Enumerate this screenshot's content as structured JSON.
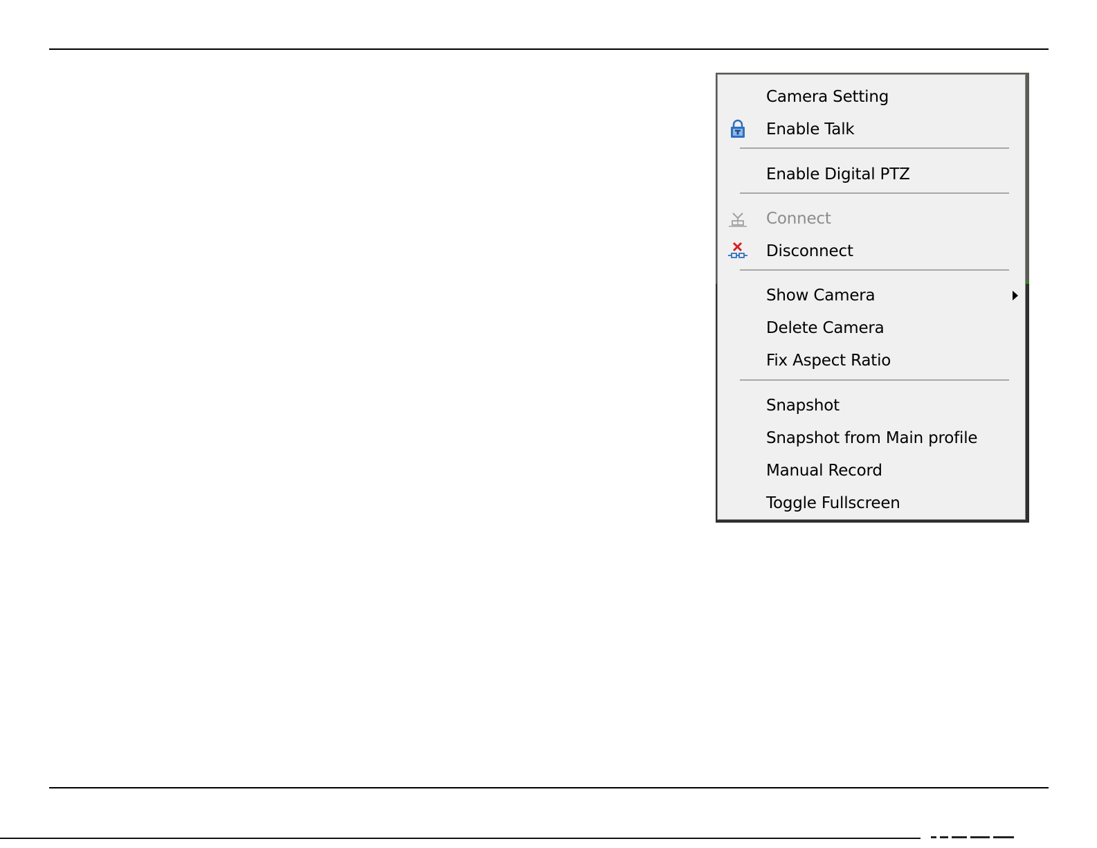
{
  "page": {
    "background": "#ffffff"
  },
  "context_menu": {
    "items": [
      {
        "label": "Camera Setting",
        "icon": "",
        "disabled": false,
        "submenu": false
      },
      {
        "label": "Enable Talk",
        "icon": "lock-talk-icon",
        "disabled": false,
        "submenu": false
      },
      {
        "label": "Enable Digital PTZ",
        "icon": "",
        "disabled": false,
        "submenu": false
      },
      {
        "label": "Connect",
        "icon": "connect-icon",
        "disabled": true,
        "submenu": false
      },
      {
        "label": "Disconnect",
        "icon": "disconnect-icon",
        "disabled": false,
        "submenu": false
      },
      {
        "label": "Show Camera",
        "icon": "",
        "disabled": false,
        "submenu": true
      },
      {
        "label": "Delete Camera",
        "icon": "",
        "disabled": false,
        "submenu": false
      },
      {
        "label": "Fix Aspect Ratio",
        "icon": "",
        "disabled": false,
        "submenu": false
      },
      {
        "label": "Snapshot",
        "icon": "",
        "disabled": false,
        "submenu": false
      },
      {
        "label": "Snapshot from Main profile",
        "icon": "",
        "disabled": false,
        "submenu": false
      },
      {
        "label": "Manual Record",
        "icon": "",
        "disabled": false,
        "submenu": false
      },
      {
        "label": "Toggle Fullscreen",
        "icon": "",
        "disabled": false,
        "submenu": false
      }
    ],
    "colors": {
      "menu_bg": "#f0f0f0",
      "text": "#000000",
      "disabled_text": "#8c8c8c",
      "separator": "#a8a8a8",
      "icon_blue": "#2f6fbf",
      "icon_red": "#d42020"
    }
  }
}
